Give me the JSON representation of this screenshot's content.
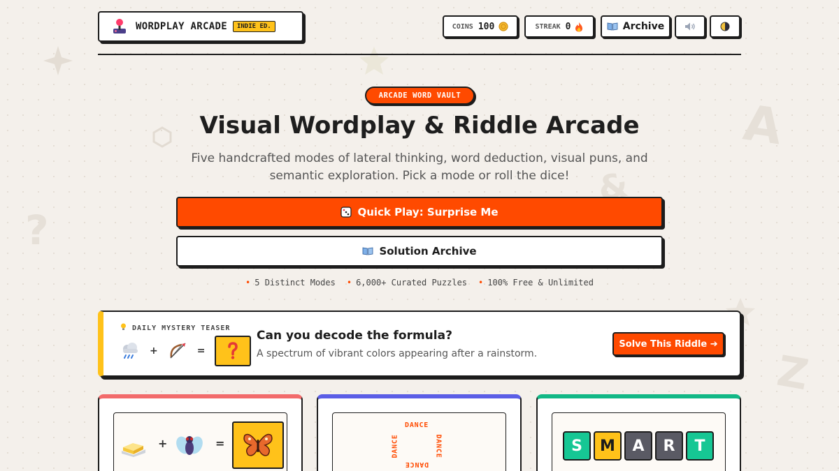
{
  "colors": {
    "accent": "#ff4a00",
    "gold": "#ffc21a",
    "ink": "#1c1c1c",
    "background": "#f4f0eb",
    "card_red": "#f26b6b",
    "card_blue": "#5b5ee6",
    "card_green": "#12b886",
    "tile_green": "#16c794",
    "tile_gray": "#5a5a64"
  },
  "decorations": [
    "A",
    "&",
    "?",
    "Z"
  ],
  "header": {
    "brand_icon": "joystick-icon",
    "brand_title": "WORDPLAY ARCADE",
    "brand_badge": "INDIE ED.",
    "coins_label": "COINS",
    "coins_value": "100",
    "coins_icon": "coin-icon",
    "streak_label": "STREAK",
    "streak_value": "0",
    "streak_icon": "fire-icon",
    "archive_icon": "book-icon",
    "archive_label": "Archive",
    "sound_icon": "speaker-icon",
    "theme_icon": "half-moon-icon"
  },
  "hero": {
    "tag": "ARCADE WORD VAULT",
    "title": "Visual Wordplay & Riddle Arcade",
    "subtitle": "Five handcrafted modes of lateral thinking, word deduction, visual puns, and semantic exploration. Pick a mode or roll the dice!",
    "quick_play_icon": "dice-icon",
    "quick_play": "Quick Play: Surprise Me",
    "archive_icon": "book-icon",
    "archive_button": "Solution Archive",
    "stats": [
      "5 Distinct Modes",
      "6,000+ Curated Puzzles",
      "100% Free & Unlimited"
    ]
  },
  "teaser": {
    "label_icon": "lightbulb-icon",
    "label": "DAILY MYSTERY TEASER",
    "formula": {
      "item1": "rain-cloud-icon",
      "plus": "+",
      "item2": "bow-and-arrow-icon",
      "equals": "=",
      "result": "question-mark-icon"
    },
    "question": "Can you decode the formula?",
    "hint": "A spectrum of vibrant colors appearing after a rainstorm.",
    "solve_button": "Solve This Riddle ➔"
  },
  "cards": [
    {
      "theme": "card_red",
      "puzzle": {
        "item1": "butter-icon",
        "plus": "+",
        "item2": "fly-icon",
        "equals": "=",
        "result": "butterfly-icon"
      }
    },
    {
      "theme": "card_blue",
      "puzzle": {
        "words": [
          "DANCE",
          "DANCE",
          "DANCE",
          "DANCE"
        ]
      }
    },
    {
      "theme": "card_green",
      "puzzle": {
        "letters": [
          "S",
          "M",
          "A",
          "R",
          "T"
        ],
        "states": [
          "correct",
          "present",
          "absent",
          "absent",
          "correct"
        ]
      }
    }
  ]
}
